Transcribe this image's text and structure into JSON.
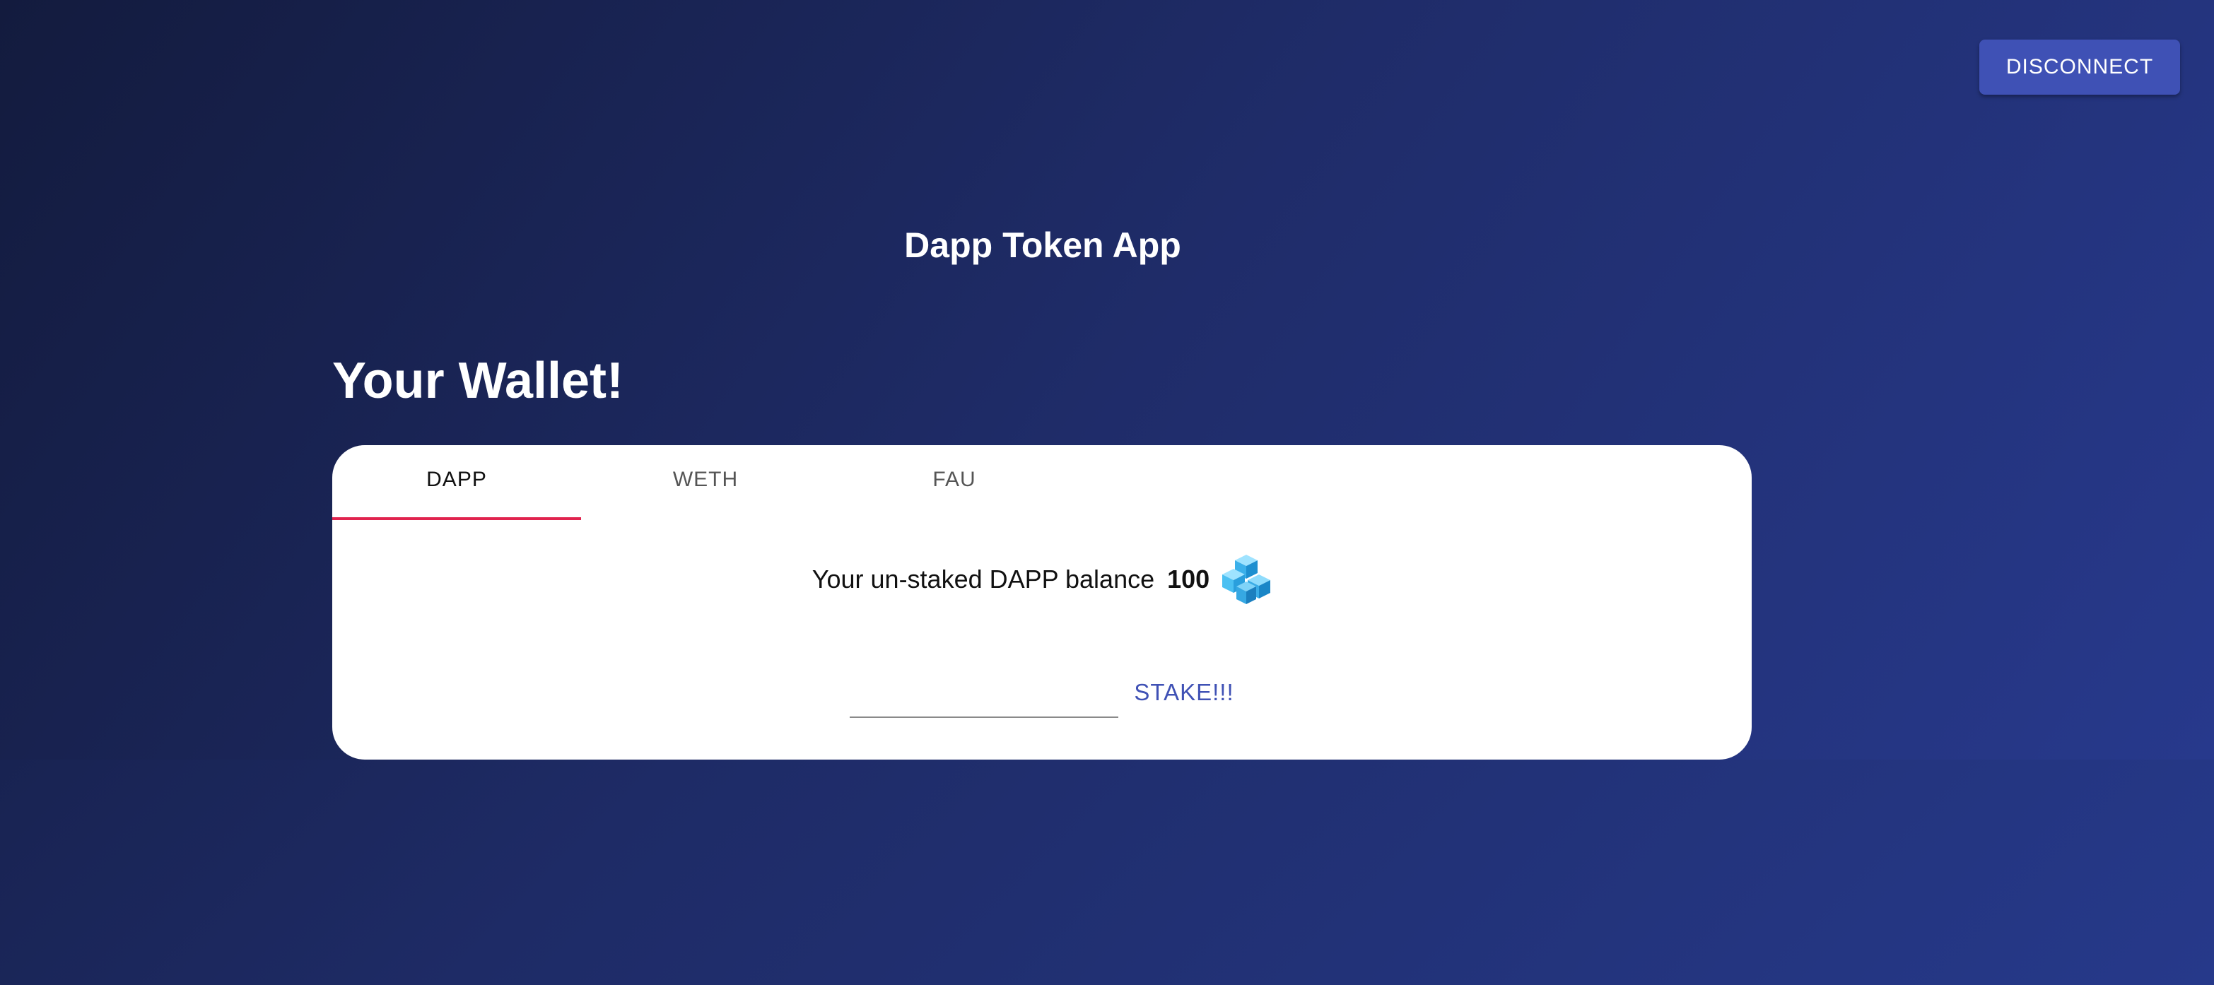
{
  "header": {
    "disconnect_label": "DISCONNECT",
    "app_title": "Dapp Token App"
  },
  "wallet": {
    "title": "Your Wallet!",
    "tabs": [
      {
        "label": "DAPP",
        "active": true
      },
      {
        "label": "WETH",
        "active": false
      },
      {
        "label": "FAU",
        "active": false
      }
    ],
    "balance_label": "Your un-staked DAPP balance",
    "balance_value": "100",
    "token_icon": "dapp-token-icon",
    "stake_input_value": "",
    "stake_button_label": "STAKE!!!"
  },
  "colors": {
    "accent": "#3f51b5",
    "tab_indicator": "#e0234e",
    "background_start": "#121a3b",
    "background_end": "#26398a"
  }
}
